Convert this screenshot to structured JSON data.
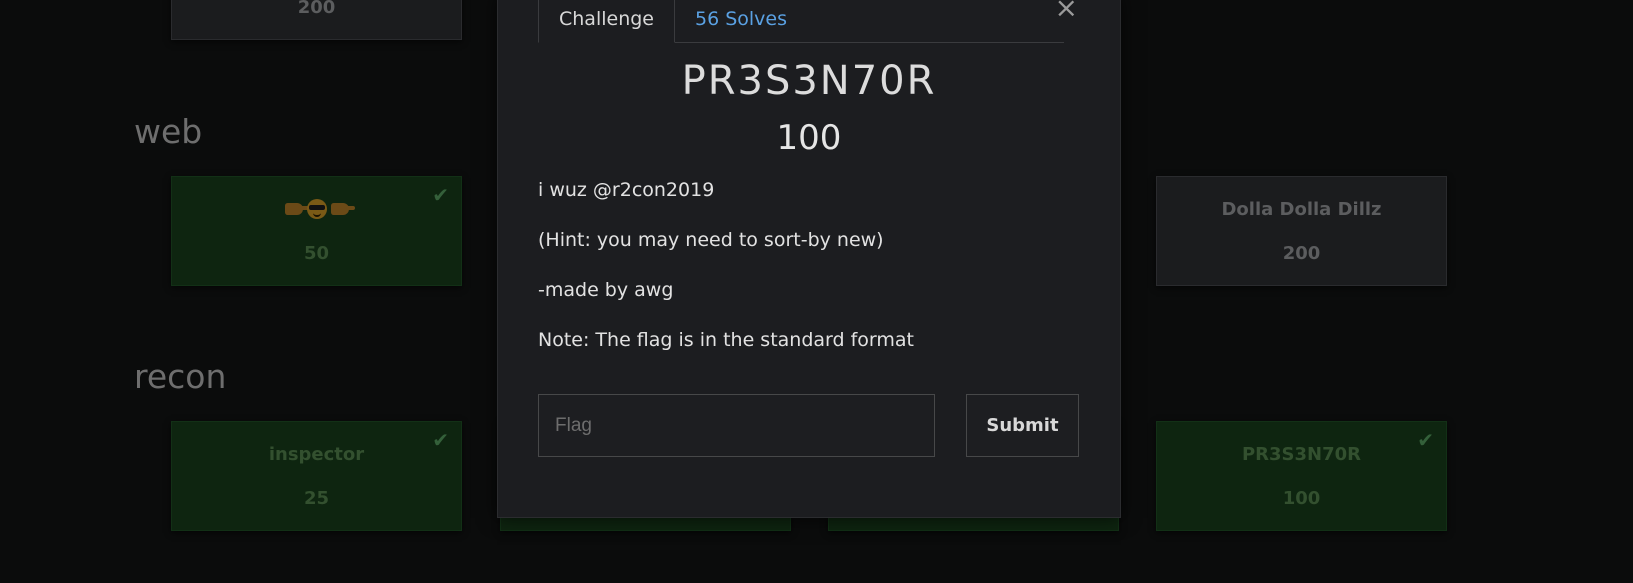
{
  "colors": {
    "background": "#0b0c0c",
    "card_unsolved": "#1b1c1e",
    "card_solved": "#0e2510",
    "modal": "#1c1d20",
    "solves_link": "#5aa1e3"
  },
  "board": {
    "top_card": {
      "points": "200"
    },
    "categories": [
      {
        "name": "web"
      },
      {
        "name": "recon"
      }
    ],
    "web_cards": [
      {
        "name_icons": [
          "point-right-emoji-icon",
          "cool-face-emoji-icon",
          "point-right-emoji-icon"
        ],
        "points": "50",
        "solved": true
      },
      {
        "name": "Dolla Dolla Dillz",
        "points": "200",
        "solved": false
      }
    ],
    "recon_cards": [
      {
        "name": "inspector",
        "points": "25",
        "solved": true
      },
      {
        "name": "PR3S3N70R",
        "points": "100",
        "solved": true
      }
    ],
    "check_icon": "checkmark-icon"
  },
  "modal": {
    "close_icon": "close-icon",
    "close_symbol": "×",
    "tabs": [
      {
        "label": "Challenge"
      },
      {
        "label": "56 Solves"
      }
    ],
    "title": "PR3S3N70R",
    "points": "100",
    "description": [
      "i wuz @r2con2019",
      "(Hint: you may need to sort-by new)",
      "-made by awg",
      "Note: The flag is in the standard format"
    ],
    "flag_input": {
      "value": "",
      "placeholder": "Flag"
    },
    "submit_label": "Submit"
  }
}
